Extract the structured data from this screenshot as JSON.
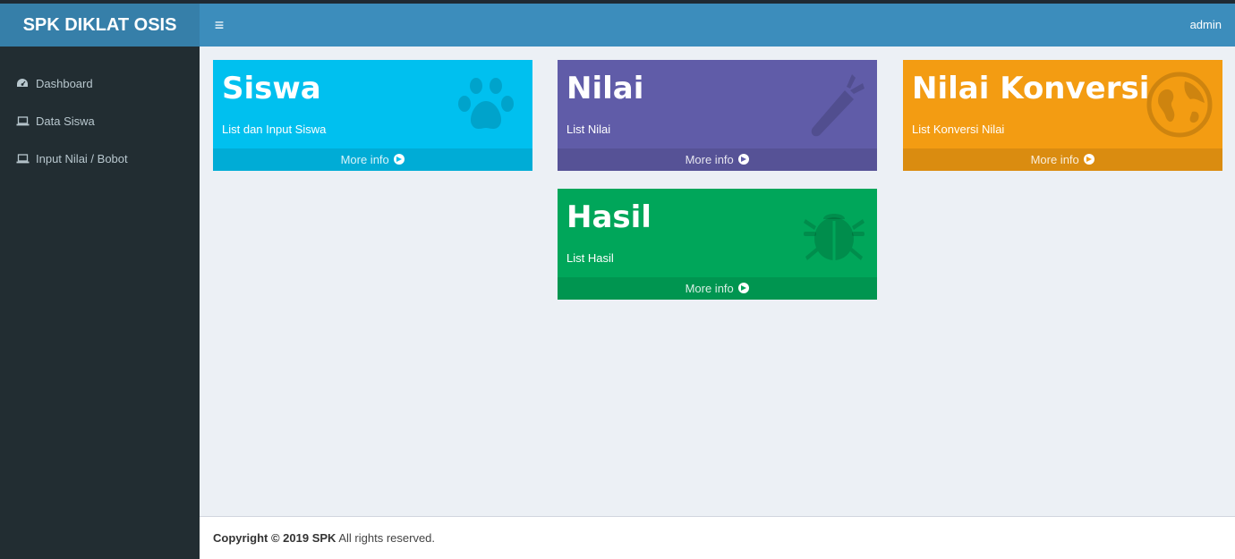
{
  "app": {
    "logo": "SPK DIKLAT OSIS"
  },
  "header": {
    "menu_icon": "hamburger-icon",
    "user": "admin"
  },
  "sidebar": {
    "items": [
      {
        "label": "Dashboard",
        "icon": "dashboard-icon"
      },
      {
        "label": "Data Siswa",
        "icon": "laptop-icon"
      },
      {
        "label": "Input Nilai / Bobot",
        "icon": "laptop-icon"
      }
    ]
  },
  "boxes": [
    {
      "title": "Siswa",
      "subtitle": "List dan Input Siswa",
      "link": "More info",
      "color": "#00c0ef",
      "icon": "paw-icon"
    },
    {
      "title": "Nilai",
      "subtitle": "List Nilai",
      "link": "More info",
      "color": "#605ca8",
      "icon": "carrot-icon"
    },
    {
      "title": "Nilai Konversi",
      "subtitle": "List Konversi Nilai",
      "link": "More info",
      "color": "#f39c12",
      "icon": "globe-icon"
    },
    {
      "title": "Hasil",
      "subtitle": "List Hasil",
      "link": "More info",
      "color": "#00a65a",
      "icon": "bug-icon"
    }
  ],
  "footer": {
    "copyright": "Copyright © 2019 SPK",
    "rights": "All rights reserved."
  }
}
